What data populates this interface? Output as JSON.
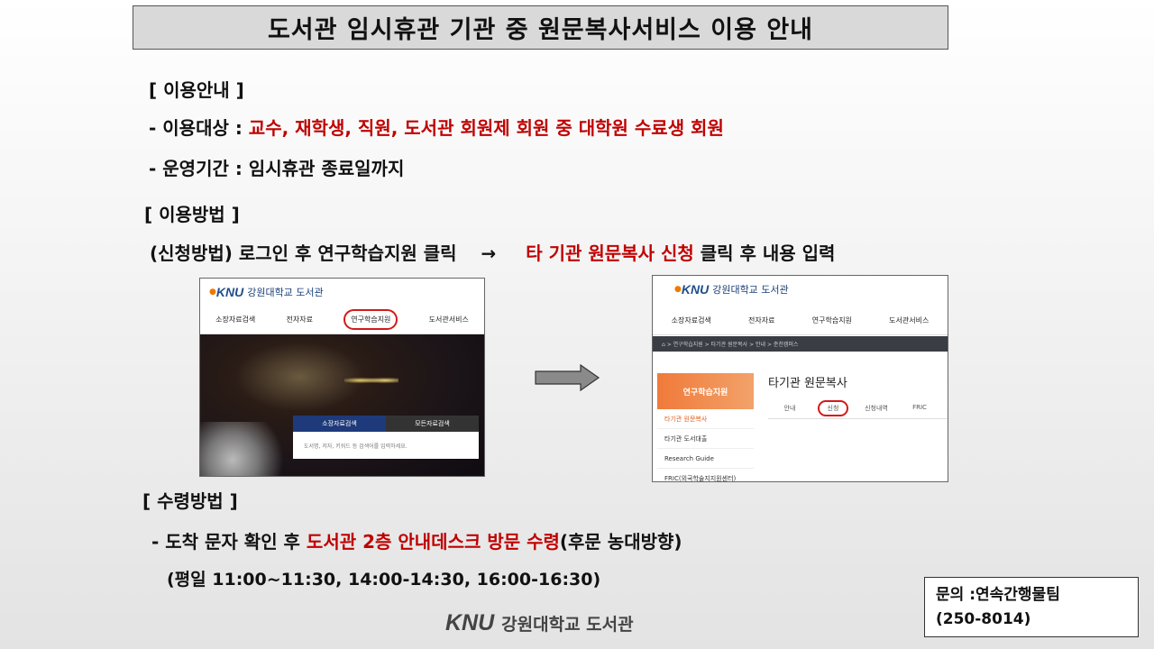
{
  "title": "도서관 임시휴관 기관 중 원문복사서비스 이용 안내",
  "usage": {
    "heading": "[ 이용안내 ]",
    "target_label": "- 이용대상 : ",
    "target_value": "교수, 재학생, 직원, 도서관 회원제 회원 중 대학원 수료생 회원",
    "period_label": "- 운영기간 : ",
    "period_value": "임시휴관 종료일까지"
  },
  "method": {
    "heading": "[ 이용방법 ]",
    "step_prefix": "(신청방법) 로그인 후 연구학습지원 클릭",
    "arrow": "→",
    "step_red": "타 기관 원문복사 신청",
    "step_suffix": " 클릭 후 내용 입력"
  },
  "shot1": {
    "logo": "KNU",
    "logo_name": "강원대학교 도서관",
    "menu": [
      "소장자료검색",
      "전자자료",
      "연구학습지원",
      "도서관서비스"
    ],
    "search_tabs": [
      "소장자료검색",
      "모든자료검색"
    ],
    "search_placeholder": "도서명, 저자, 키워드 등 검색어를 입력하세요."
  },
  "shot2": {
    "logo": "KNU",
    "logo_name": "강원대학교 도서관",
    "menu": [
      "소장자료검색",
      "전자자료",
      "연구학습지원",
      "도서관서비스"
    ],
    "breadcrumb": "⌂  >  연구학습지원  >  타기관 원문복사  >  안내  >  춘천캠퍼스",
    "sidebar_title": "연구학습지원",
    "sidebar_items": [
      "타기관 원문복사",
      "타기관 도서대출",
      "Research Guide",
      "FRIC(외국학술지지원센터)"
    ],
    "content_title": "타기관 원문복사",
    "tabs": [
      "안내",
      "신청",
      "신청내역",
      "FRIC"
    ]
  },
  "receive": {
    "heading": "[ 수령방법 ]",
    "line_prefix": "- 도착 문자 확인 후 ",
    "line_red": "도서관 2층 안내데스크 방문 수령",
    "line_suffix": "(후문 농대방향)",
    "hours": "(평일 11:00~11:30, 14:00-14:30, 16:00-16:30)"
  },
  "contact": {
    "line1": "문의 :연속간행물팀",
    "line2": "(250-8014)"
  },
  "footer": {
    "logo": "KNU",
    "name": "강원대학교 도서관"
  }
}
